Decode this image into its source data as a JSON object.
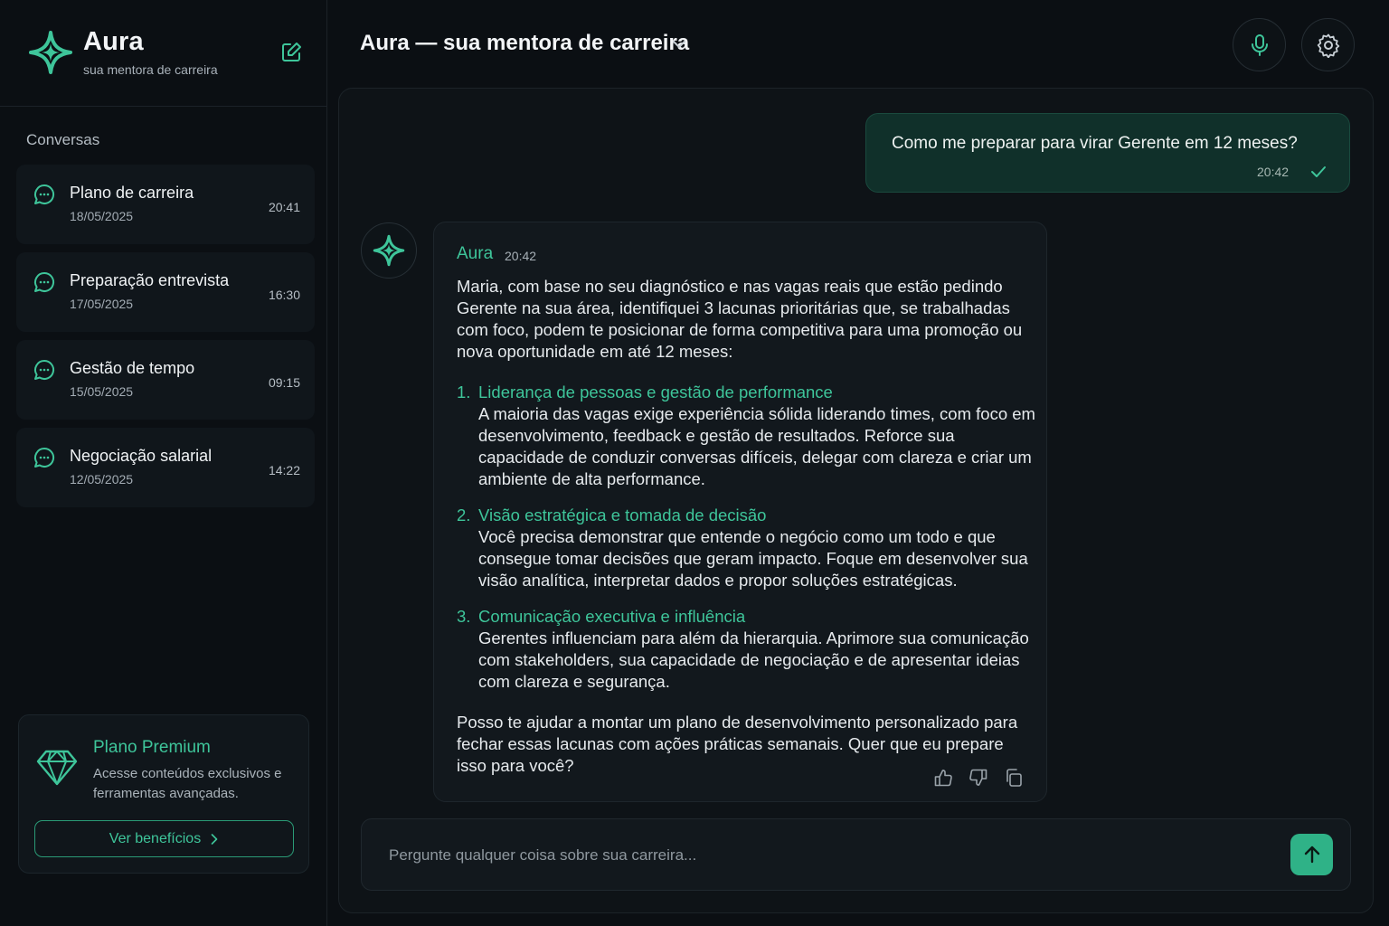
{
  "sidebar": {
    "brand_name": "Aura",
    "brand_subtitle": "sua mentora de carreira",
    "section_title": "Conversas",
    "conversations": [
      {
        "title": "Plano de carreira",
        "date": "18/05/2025",
        "time": "20:41"
      },
      {
        "title": "Preparação entrevista",
        "date": "17/05/2025",
        "time": "16:30"
      },
      {
        "title": "Gestão de tempo",
        "date": "15/05/2025",
        "time": "09:15"
      },
      {
        "title": "Negociação salarial",
        "date": "12/05/2025",
        "time": "14:22"
      }
    ],
    "premium": {
      "title": "Plano Premium",
      "description": "Acesse conteúdos exclusivos e ferramentas avançadas.",
      "button_label": "Ver benefícios"
    }
  },
  "header": {
    "title": "Aura — sua mentora de carreira"
  },
  "chat": {
    "user_message": {
      "text": "Como me preparar para virar Gerente em 12 meses?",
      "time": "20:42"
    },
    "ai_message": {
      "sender": "Aura",
      "time": "20:42",
      "intro": "Maria, com base no seu diagnóstico e nas vagas reais que estão pedindo Gerente na sua área, identifiquei 3 lacunas prioritárias que, se trabalhadas com foco, podem te posicionar de forma competitiva para uma promoção ou nova oportunidade em até 12 meses:",
      "items": [
        {
          "num": "1.",
          "title": "Liderança de pessoas e gestão de performance",
          "desc": "A maioria das vagas exige experiência sólida liderando times, com foco em desenvolvimento, feedback e gestão de resultados. Reforce sua capacidade de conduzir conversas difíceis, delegar com clareza e criar um ambiente de alta performance."
        },
        {
          "num": "2.",
          "title": "Visão estratégica e tomada de decisão",
          "desc": "Você precisa demonstrar que entende o negócio como um todo e que consegue tomar decisões que geram impacto. Foque em desenvolver sua visão analítica, interpretar dados e propor soluções estratégicas."
        },
        {
          "num": "3.",
          "title": "Comunicação executiva e influência",
          "desc": "Gerentes influenciam para além da hierarquia. Aprimore sua comunicação com stakeholders, sua capacidade de negociação e de apresentar ideias com clareza e segurança."
        }
      ],
      "outro": "Posso te ajudar a montar um plano de desenvolvimento personalizado para fechar essas lacunas com ações práticas semanais. Quer que eu prepare isso para você?"
    }
  },
  "composer": {
    "placeholder": "Pergunte qualquer coisa sobre sua carreira...",
    "value": ""
  },
  "colors": {
    "accent": "#3ec59a",
    "background": "#0b0f13",
    "user_bubble": "#10302a",
    "send_button": "#2fb287"
  },
  "icons": {
    "brand": "sparkle-icon",
    "new_chat": "edit-icon",
    "conversation": "chat-bubble-icon",
    "premium": "diamond-icon",
    "dropdown": "chevron-down-icon",
    "mic": "microphone-icon",
    "settings": "gear-icon",
    "check": "check-icon",
    "like": "thumbs-up-icon",
    "dislike": "thumbs-down-icon",
    "copy": "copy-icon",
    "send": "arrow-up-icon"
  }
}
